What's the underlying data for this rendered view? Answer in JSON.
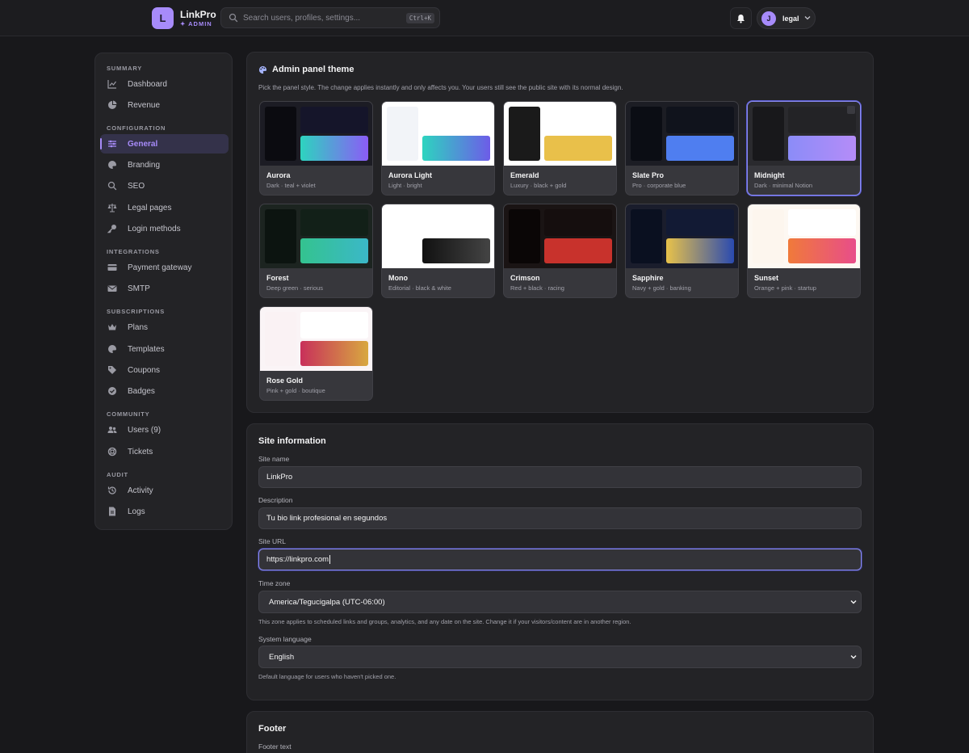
{
  "brand": {
    "initial": "L",
    "name": "LinkPro",
    "badge": "ADMIN"
  },
  "search": {
    "placeholder": "Search users, profiles, settings...",
    "shortcut": "Ctrl+K"
  },
  "user": {
    "initial": "J",
    "name": "legal"
  },
  "sidebar": {
    "sections": [
      {
        "label": "SUMMARY",
        "items": [
          {
            "label": "Dashboard",
            "icon": "chart-line-icon"
          },
          {
            "label": "Revenue",
            "icon": "pie-chart-icon"
          }
        ]
      },
      {
        "label": "CONFIGURATION",
        "items": [
          {
            "label": "General",
            "icon": "sliders-icon",
            "active": true
          },
          {
            "label": "Branding",
            "icon": "palette-icon"
          },
          {
            "label": "SEO",
            "icon": "search-icon"
          },
          {
            "label": "Legal pages",
            "icon": "scale-icon"
          },
          {
            "label": "Login methods",
            "icon": "key-icon"
          }
        ]
      },
      {
        "label": "INTEGRATIONS",
        "items": [
          {
            "label": "Payment gateway",
            "icon": "credit-card-icon"
          },
          {
            "label": "SMTP",
            "icon": "envelope-icon"
          }
        ]
      },
      {
        "label": "SUBSCRIPTIONS",
        "items": [
          {
            "label": "Plans",
            "icon": "crown-icon"
          },
          {
            "label": "Templates",
            "icon": "palette-icon"
          },
          {
            "label": "Coupons",
            "icon": "tag-icon"
          },
          {
            "label": "Badges",
            "icon": "badge-check-icon"
          }
        ]
      },
      {
        "label": "COMMUNITY",
        "items": [
          {
            "label": "Users (9)",
            "icon": "users-icon"
          },
          {
            "label": "Tickets",
            "icon": "lifebuoy-icon"
          }
        ]
      },
      {
        "label": "AUDIT",
        "items": [
          {
            "label": "Activity",
            "icon": "history-icon"
          },
          {
            "label": "Logs",
            "icon": "file-icon"
          }
        ]
      }
    ]
  },
  "theme_panel": {
    "title": "Admin panel theme",
    "description": "Pick the panel style. The change applies instantly and only affects you. Your users still see the public site with its normal design.",
    "selected": "Midnight",
    "themes": [
      {
        "name": "Aurora",
        "sub": "Dark · teal + violet",
        "bg": "#1c1c24",
        "side": "#0b0b10",
        "head": "#15152a",
        "accent": "linear-gradient(90deg,#2dd4bf,#8b5cf6)"
      },
      {
        "name": "Aurora Light",
        "sub": "Light · bright",
        "bg": "#ffffff",
        "side": "#f2f4f8",
        "head": "#ffffff",
        "accent": "linear-gradient(90deg,#2dd4bf,#6d5ce8)"
      },
      {
        "name": "Emerald",
        "sub": "Luxury · black + gold",
        "bg": "#ffffff",
        "side": "#1a1a1a",
        "head": "#ffffff",
        "accent": "#e9c04a"
      },
      {
        "name": "Slate Pro",
        "sub": "Pro · corporate blue",
        "bg": "#1c1d24",
        "side": "#0b0d14",
        "head": "#10131c",
        "accent": "#4f7ef0"
      },
      {
        "name": "Midnight",
        "sub": "Dark · minimal Notion",
        "bg": "#2a2a2e",
        "side": "#18181b",
        "head": "#232326",
        "accent": "linear-gradient(90deg,#8b8cf8,#b58cf8)"
      },
      {
        "name": "Forest",
        "sub": "Deep green · serious",
        "bg": "#1c2420",
        "side": "#0c1410",
        "head": "#122018",
        "accent": "linear-gradient(90deg,#34c38f,#3bb8c8)"
      },
      {
        "name": "Mono",
        "sub": "Editorial · black & white",
        "bg": "#ffffff",
        "side": "#ffffff",
        "head": "#ffffff",
        "accent": "linear-gradient(90deg,#111111,#444444)"
      },
      {
        "name": "Crimson",
        "sub": "Red + black · racing",
        "bg": "#1a1414",
        "side": "#0a0606",
        "head": "#150e0e",
        "accent": "#c8322c"
      },
      {
        "name": "Sapphire",
        "sub": "Navy + gold · banking",
        "bg": "#1a1d2c",
        "side": "#0a1020",
        "head": "#121a34",
        "accent": "linear-gradient(90deg,#e8c24a,#2a4ab0)"
      },
      {
        "name": "Sunset",
        "sub": "Orange + pink · startup",
        "bg": "#fdf8f2",
        "side": "#fdf6ee",
        "head": "#ffffff",
        "accent": "linear-gradient(90deg,#f07a3a,#e84d8a)"
      },
      {
        "name": "Rose Gold",
        "sub": "Pink + gold · boutique",
        "bg": "#faf4f6",
        "side": "#faf2f4",
        "head": "#ffffff",
        "accent": "linear-gradient(90deg,#c8305a,#d8a840)"
      }
    ]
  },
  "site_panel": {
    "title": "Site information",
    "site_name_label": "Site name",
    "site_name": "LinkPro",
    "description_label": "Description",
    "description": "Tu bio link profesional en segundos",
    "site_url_label": "Site URL",
    "site_url": "https://linkpro.com",
    "timezone_label": "Time zone",
    "timezone": "America/Tegucigalpa (UTC-06:00)",
    "timezone_help": "This zone applies to scheduled links and groups, analytics, and any date on the site. Change it if your visitors/content are in another region.",
    "language_label": "System language",
    "language": "English",
    "language_help": "Default language for users who haven't picked one."
  },
  "footer_panel": {
    "title": "Footer",
    "footer_text_label": "Footer text"
  }
}
